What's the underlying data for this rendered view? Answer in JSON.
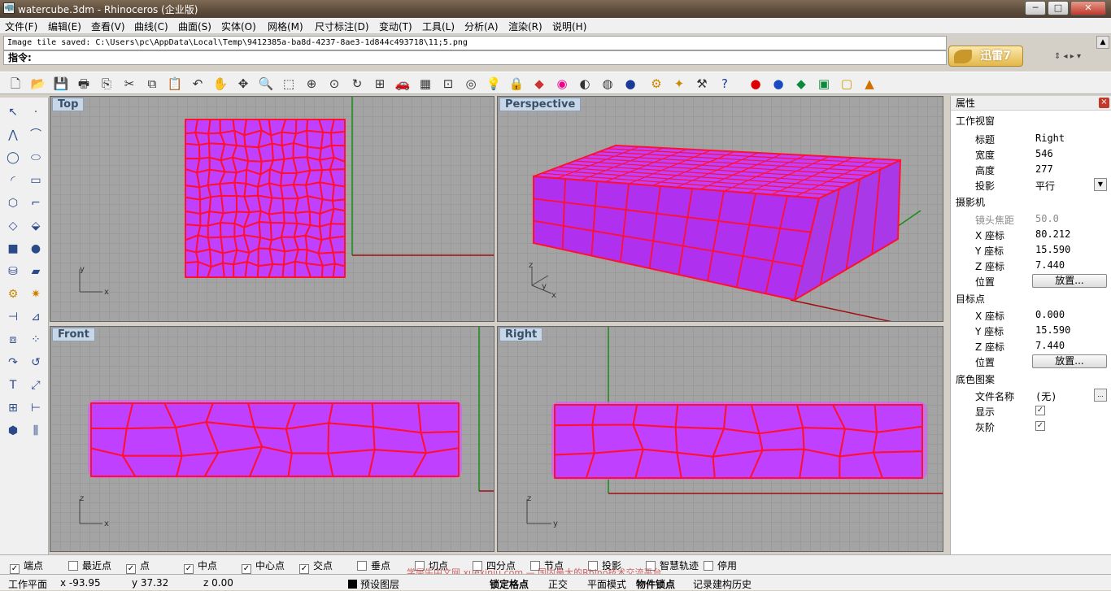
{
  "window": {
    "title": "watercube.3dm - Rhinoceros (企业版)",
    "min": "─",
    "max": "□",
    "close": "✕"
  },
  "menu": [
    "文件(F)",
    "编辑(E)",
    "查看(V)",
    "曲线(C)",
    "曲面(S)",
    "实体(O)",
    "网格(M)",
    "尺寸标注(D)",
    "变动(T)",
    "工具(L)",
    "分析(A)",
    "渲染(R)",
    "说明(H)"
  ],
  "command": {
    "history": "Image tile saved: C:\\Users\\pc\\AppData\\Local\\Temp\\9412385a-ba8d-4237-8ae3-1d844c493718\\11;5.png",
    "prompt": "指令:"
  },
  "promo": {
    "label": "迅雷7"
  },
  "toolbar_icons": [
    "new-icon",
    "open-icon",
    "save-icon",
    "print-icon",
    "import-icon",
    "cut-icon",
    "copy-icon",
    "paste-icon",
    "undo-icon",
    "pan-icon",
    "rotate-view-icon",
    "zoom-icon",
    "zoom-window-icon",
    "zoom-extents-icon",
    "zoom-selected-icon",
    "rotate-icon",
    "four-viewports-icon",
    "car-icon",
    "grid-icon",
    "snap-icon",
    "target-icon",
    "light-icon",
    "lock-icon",
    "layer-icon",
    "color-wheel-icon",
    "sphere-wire-icon",
    "sphere-mesh-icon",
    "render-sphere-icon",
    "settings-icon",
    "select-icon",
    "tools-icon",
    "help-icon",
    "red-sphere-icon",
    "blue-sphere-icon",
    "green-gem-icon",
    "green-box-icon",
    "yellow-frame-icon",
    "cone-icon"
  ],
  "viewports": {
    "top": {
      "label": "Top",
      "axis1": "y",
      "axis2": "x"
    },
    "perspective": {
      "label": "Perspective",
      "axis1": "z",
      "axis2": "y",
      "axis3": "x"
    },
    "front": {
      "label": "Front",
      "axis1": "z",
      "axis2": "x"
    },
    "right": {
      "label": "Right",
      "axis1": "z",
      "axis2": "y"
    }
  },
  "properties": {
    "header": "属性",
    "viewport_section": "工作视窗",
    "title_label": "标题",
    "title_value": "Right",
    "width_label": "宽度",
    "width_value": "546",
    "height_label": "高度",
    "height_value": "277",
    "projection_label": "投影",
    "projection_value": "平行",
    "camera_section": "摄影机",
    "lens_label": "镜头焦距",
    "lens_value": "50.0",
    "cam_x_label": "X 座标",
    "cam_x_value": "80.212",
    "cam_y_label": "Y 座标",
    "cam_y_value": "15.590",
    "cam_z_label": "Z 座标",
    "cam_z_value": "7.440",
    "cam_pos_label": "位置",
    "cam_pos_button": "放置...",
    "target_section": "目标点",
    "tgt_x_label": "X 座标",
    "tgt_x_value": "0.000",
    "tgt_y_label": "Y 座标",
    "tgt_y_value": "15.590",
    "tgt_z_label": "Z 座标",
    "tgt_z_value": "7.440",
    "tgt_pos_label": "位置",
    "tgt_pos_button": "放置...",
    "bg_section": "底色图案",
    "file_label": "文件名称",
    "file_value": "(无)",
    "file_button": "...",
    "show_label": "显示",
    "gray_label": "灰阶"
  },
  "osnap": [
    {
      "label": "端点",
      "checked": true
    },
    {
      "label": "最近点",
      "checked": false
    },
    {
      "label": "点",
      "checked": true
    },
    {
      "label": "中点",
      "checked": true
    },
    {
      "label": "中心点",
      "checked": true
    },
    {
      "label": "交点",
      "checked": true
    },
    {
      "label": "垂点",
      "checked": false
    },
    {
      "label": "切点",
      "checked": false
    },
    {
      "label": "四分点",
      "checked": false
    },
    {
      "label": "节点",
      "checked": false
    },
    {
      "label": "投影",
      "checked": false
    },
    {
      "label": "智慧轨迹",
      "checked": false
    },
    {
      "label": "停用",
      "checked": false
    }
  ],
  "status": {
    "cplane": "工作平面",
    "x": "x -93.95",
    "y": "y 37.32",
    "z": "z 0.00",
    "layer": "预设图层",
    "grid_snap": "锁定格点",
    "ortho": "正交",
    "planar": "平面模式",
    "osnap": "物件锁点",
    "history": "记录建构历史"
  },
  "watermark": "学犀牛中文网  xuexiniu.com  —  国内最大的Rhino技术交流平台",
  "colors": {
    "cell_fill": "#c040ff",
    "cell_edge": "#ff1030",
    "viewport_bg": "#a4a4a4"
  }
}
